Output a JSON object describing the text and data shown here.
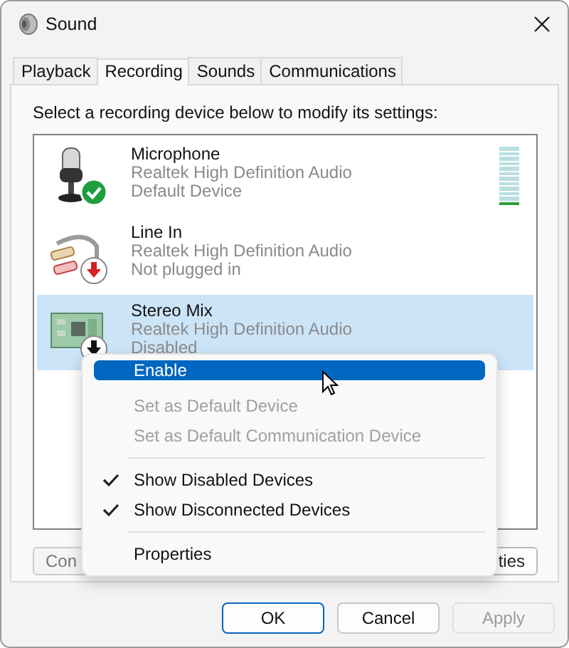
{
  "window": {
    "title": "Sound"
  },
  "tabs": [
    {
      "label": "Playback",
      "selected": false
    },
    {
      "label": "Recording",
      "selected": true
    },
    {
      "label": "Sounds",
      "selected": false
    },
    {
      "label": "Communications",
      "selected": false
    }
  ],
  "instruction": "Select a recording device below to modify its settings:",
  "devices": [
    {
      "kind": "microphone",
      "name": "Microphone",
      "driver": "Realtek High Definition Audio",
      "status_text": "Default Device",
      "badge": {
        "kind": "check"
      },
      "selected": false,
      "level": 0.08
    },
    {
      "kind": "line-in",
      "name": "Line In",
      "driver": "Realtek High Definition Audio",
      "status_text": "Not plugged in",
      "badge": {
        "kind": "unplugged"
      },
      "selected": false
    },
    {
      "kind": "sound-card",
      "name": "Stereo Mix",
      "driver": "Realtek High Definition Audio",
      "status_text": "Disabled",
      "badge": {
        "kind": "disabled"
      },
      "selected": true
    }
  ],
  "panel_buttons": [
    {
      "label": "Con"
    },
    {
      "label": "ties"
    }
  ],
  "context_menu": [
    {
      "kind": "item",
      "label": "Enable",
      "selected": true,
      "disabled": false,
      "checked": false
    },
    {
      "kind": "item",
      "label": "Set as Default Device",
      "selected": false,
      "disabled": true,
      "checked": false
    },
    {
      "kind": "item",
      "label": "Set as Default Communication Device",
      "selected": false,
      "disabled": true,
      "checked": false
    },
    {
      "kind": "separator"
    },
    {
      "kind": "item",
      "label": "Show Disabled Devices",
      "selected": false,
      "disabled": false,
      "checked": true
    },
    {
      "kind": "item",
      "label": "Show Disconnected Devices",
      "selected": false,
      "disabled": false,
      "checked": true
    },
    {
      "kind": "separator"
    },
    {
      "kind": "item",
      "label": "Properties",
      "selected": false,
      "disabled": false,
      "checked": false
    }
  ],
  "buttons": [
    {
      "label": "OK",
      "default": true,
      "disabled": false
    },
    {
      "label": "Cancel",
      "default": false,
      "disabled": false
    },
    {
      "label": "Apply",
      "default": false,
      "disabled": true
    }
  ]
}
